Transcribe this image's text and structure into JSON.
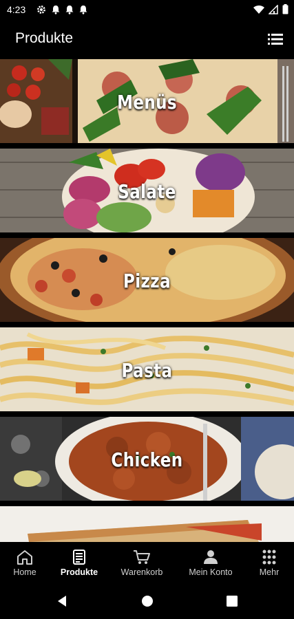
{
  "status_bar": {
    "time": "4:23",
    "left_icons": [
      "gear-icon",
      "bell-icon",
      "bell-icon",
      "bell-icon"
    ],
    "right_icons": [
      "wifi-icon",
      "signal-icon",
      "battery-icon"
    ]
  },
  "app_bar": {
    "title": "Produkte",
    "action_icon": "list-icon"
  },
  "categories": [
    {
      "label": "Menüs"
    },
    {
      "label": "Salate"
    },
    {
      "label": "Pizza"
    },
    {
      "label": "Pasta"
    },
    {
      "label": "Chicken"
    }
  ],
  "bottom_nav": {
    "active": "Produkte",
    "items": [
      {
        "label": "Home",
        "icon": "home-icon"
      },
      {
        "label": "Produkte",
        "icon": "menu-card-icon"
      },
      {
        "label": "Warenkorb",
        "icon": "cart-icon"
      },
      {
        "label": "Mein Konto",
        "icon": "person-icon"
      },
      {
        "label": "Mehr",
        "icon": "grid-icon"
      }
    ]
  },
  "system_nav": [
    "back-icon",
    "home-circle-icon",
    "recents-icon"
  ]
}
